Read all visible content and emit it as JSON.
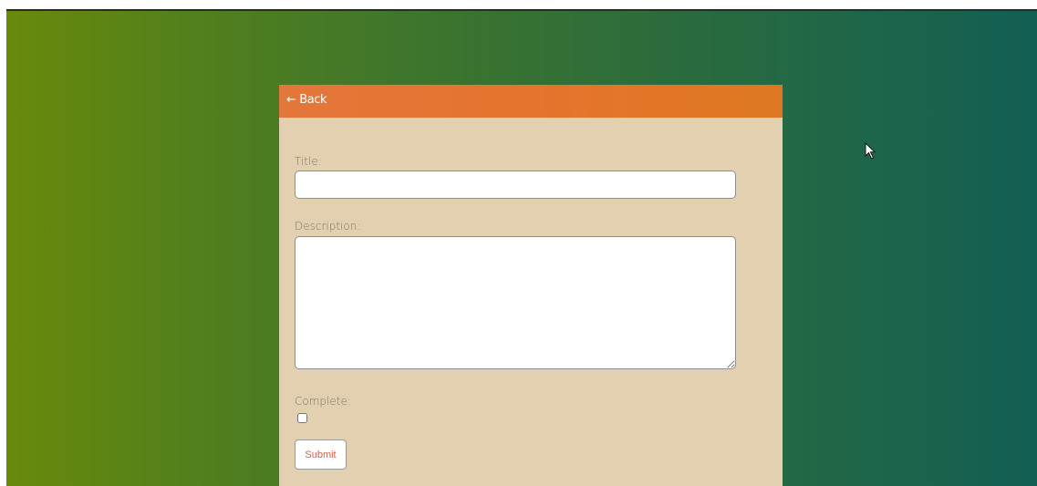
{
  "header": {
    "back_label": "← Back"
  },
  "form": {
    "title_label": "Title:",
    "title_value": "",
    "description_label": "Description:",
    "description_value": "",
    "complete_label": "Complete:",
    "complete_checked": false,
    "submit_label": "Submit"
  },
  "colors": {
    "background_gradient_start": "#688a0c",
    "background_gradient_end": "#125e53",
    "card_background": "#e3d0b0",
    "header_background": "#e5742e",
    "submit_text": "#d9604e"
  },
  "icons": {
    "pointer": "mouse-pointer-icon"
  }
}
